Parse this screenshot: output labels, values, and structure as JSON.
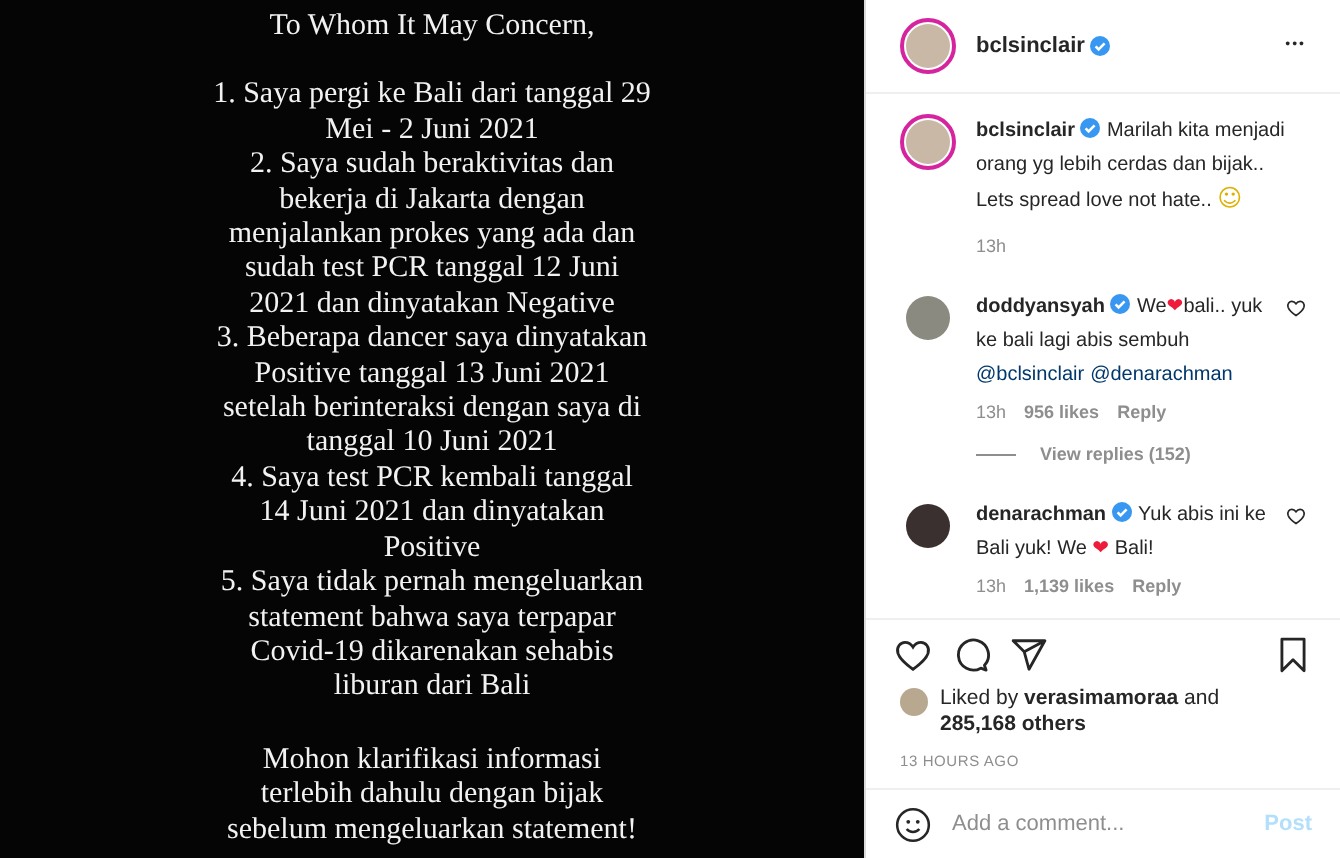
{
  "post_image": {
    "heading": "To Whom It May Concern,",
    "items": [
      "1. Saya pergi ke Bali dari tanggal 29\nMei - 2 Juni 2021",
      "2. Saya sudah beraktivitas dan\nbekerja di Jakarta dengan\nmenjalankan prokes yang ada dan\nsudah test PCR tanggal 12 Juni\n2021 dan dinyatakan Negative",
      "3. Beberapa dancer saya dinyatakan\nPositive tanggal 13 Juni 2021\nsetelah berinteraksi dengan saya di\ntanggal 10 Juni 2021",
      "4. Saya test PCR kembali tanggal\n14 Juni 2021 dan dinyatakan\nPositive",
      "5. Saya tidak pernah mengeluarkan\nstatement bahwa saya terpapar\nCovid-19 dikarenakan sehabis\nliburan dari Bali"
    ],
    "closing": "Mohon klarifikasi informasi\nterlebih dahulu dengan bijak\nsebelum mengeluarkan statement!"
  },
  "header": {
    "username": "bclsinclair",
    "verified": true,
    "more": "•••"
  },
  "caption": {
    "username": "bclsinclair",
    "verified": true,
    "segments": [
      {
        "kind": "text",
        "text": "Marilah kita menjadi orang yg lebih cerdas dan bijak.. Lets spread love not hate.. "
      },
      {
        "kind": "emoji",
        "text": "☺"
      }
    ],
    "time": "13h"
  },
  "comments": [
    {
      "username": "doddyansyah",
      "verified": true,
      "segments": [
        {
          "kind": "text",
          "text": "We"
        },
        {
          "kind": "heart",
          "text": "❤"
        },
        {
          "kind": "text",
          "text": "bali.. yuk ke bali lagi abis sembuh "
        },
        {
          "kind": "mention",
          "text": "@bclsinclair"
        },
        {
          "kind": "mention",
          "text": "@denarachman"
        }
      ],
      "time": "13h",
      "likes": "956 likes",
      "reply": "Reply",
      "view_replies": "View replies (152)",
      "liked": false
    },
    {
      "username": "denarachman",
      "verified": true,
      "segments": [
        {
          "kind": "text",
          "text": "Yuk abis ini ke Bali yuk! We "
        },
        {
          "kind": "heart",
          "text": "❤"
        },
        {
          "kind": "text",
          "text": " Bali!"
        }
      ],
      "time": "13h",
      "likes": "1,139 likes",
      "reply": "Reply",
      "liked": false
    }
  ],
  "actions": {
    "liked": false,
    "saved": false
  },
  "likes": {
    "prefix": "Liked by ",
    "user": "verasimamoraa",
    "middle": " and",
    "count": "285,168 others"
  },
  "timestamp": "13 HOURS AGO",
  "add_comment": {
    "placeholder": "Add a comment...",
    "post": "Post"
  }
}
